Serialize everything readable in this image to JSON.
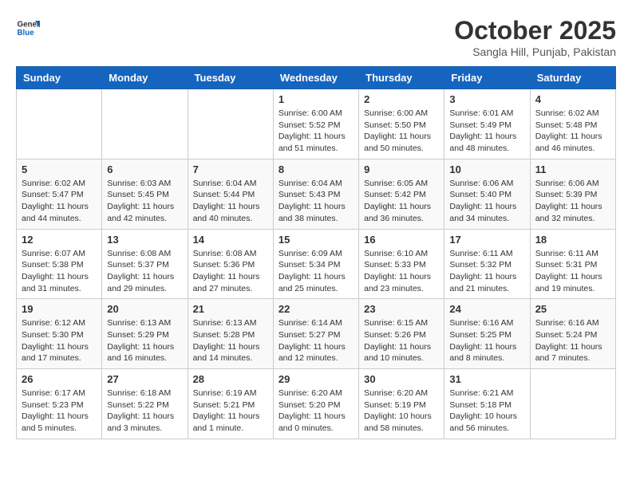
{
  "header": {
    "logo_line1": "General",
    "logo_line2": "Blue",
    "month": "October 2025",
    "location": "Sangla Hill, Punjab, Pakistan"
  },
  "weekdays": [
    "Sunday",
    "Monday",
    "Tuesday",
    "Wednesday",
    "Thursday",
    "Friday",
    "Saturday"
  ],
  "weeks": [
    [
      {
        "day": "",
        "sunrise": "",
        "sunset": "",
        "daylight": ""
      },
      {
        "day": "",
        "sunrise": "",
        "sunset": "",
        "daylight": ""
      },
      {
        "day": "",
        "sunrise": "",
        "sunset": "",
        "daylight": ""
      },
      {
        "day": "1",
        "sunrise": "Sunrise: 6:00 AM",
        "sunset": "Sunset: 5:52 PM",
        "daylight": "Daylight: 11 hours and 51 minutes."
      },
      {
        "day": "2",
        "sunrise": "Sunrise: 6:00 AM",
        "sunset": "Sunset: 5:50 PM",
        "daylight": "Daylight: 11 hours and 50 minutes."
      },
      {
        "day": "3",
        "sunrise": "Sunrise: 6:01 AM",
        "sunset": "Sunset: 5:49 PM",
        "daylight": "Daylight: 11 hours and 48 minutes."
      },
      {
        "day": "4",
        "sunrise": "Sunrise: 6:02 AM",
        "sunset": "Sunset: 5:48 PM",
        "daylight": "Daylight: 11 hours and 46 minutes."
      }
    ],
    [
      {
        "day": "5",
        "sunrise": "Sunrise: 6:02 AM",
        "sunset": "Sunset: 5:47 PM",
        "daylight": "Daylight: 11 hours and 44 minutes."
      },
      {
        "day": "6",
        "sunrise": "Sunrise: 6:03 AM",
        "sunset": "Sunset: 5:45 PM",
        "daylight": "Daylight: 11 hours and 42 minutes."
      },
      {
        "day": "7",
        "sunrise": "Sunrise: 6:04 AM",
        "sunset": "Sunset: 5:44 PM",
        "daylight": "Daylight: 11 hours and 40 minutes."
      },
      {
        "day": "8",
        "sunrise": "Sunrise: 6:04 AM",
        "sunset": "Sunset: 5:43 PM",
        "daylight": "Daylight: 11 hours and 38 minutes."
      },
      {
        "day": "9",
        "sunrise": "Sunrise: 6:05 AM",
        "sunset": "Sunset: 5:42 PM",
        "daylight": "Daylight: 11 hours and 36 minutes."
      },
      {
        "day": "10",
        "sunrise": "Sunrise: 6:06 AM",
        "sunset": "Sunset: 5:40 PM",
        "daylight": "Daylight: 11 hours and 34 minutes."
      },
      {
        "day": "11",
        "sunrise": "Sunrise: 6:06 AM",
        "sunset": "Sunset: 5:39 PM",
        "daylight": "Daylight: 11 hours and 32 minutes."
      }
    ],
    [
      {
        "day": "12",
        "sunrise": "Sunrise: 6:07 AM",
        "sunset": "Sunset: 5:38 PM",
        "daylight": "Daylight: 11 hours and 31 minutes."
      },
      {
        "day": "13",
        "sunrise": "Sunrise: 6:08 AM",
        "sunset": "Sunset: 5:37 PM",
        "daylight": "Daylight: 11 hours and 29 minutes."
      },
      {
        "day": "14",
        "sunrise": "Sunrise: 6:08 AM",
        "sunset": "Sunset: 5:36 PM",
        "daylight": "Daylight: 11 hours and 27 minutes."
      },
      {
        "day": "15",
        "sunrise": "Sunrise: 6:09 AM",
        "sunset": "Sunset: 5:34 PM",
        "daylight": "Daylight: 11 hours and 25 minutes."
      },
      {
        "day": "16",
        "sunrise": "Sunrise: 6:10 AM",
        "sunset": "Sunset: 5:33 PM",
        "daylight": "Daylight: 11 hours and 23 minutes."
      },
      {
        "day": "17",
        "sunrise": "Sunrise: 6:11 AM",
        "sunset": "Sunset: 5:32 PM",
        "daylight": "Daylight: 11 hours and 21 minutes."
      },
      {
        "day": "18",
        "sunrise": "Sunrise: 6:11 AM",
        "sunset": "Sunset: 5:31 PM",
        "daylight": "Daylight: 11 hours and 19 minutes."
      }
    ],
    [
      {
        "day": "19",
        "sunrise": "Sunrise: 6:12 AM",
        "sunset": "Sunset: 5:30 PM",
        "daylight": "Daylight: 11 hours and 17 minutes."
      },
      {
        "day": "20",
        "sunrise": "Sunrise: 6:13 AM",
        "sunset": "Sunset: 5:29 PM",
        "daylight": "Daylight: 11 hours and 16 minutes."
      },
      {
        "day": "21",
        "sunrise": "Sunrise: 6:13 AM",
        "sunset": "Sunset: 5:28 PM",
        "daylight": "Daylight: 11 hours and 14 minutes."
      },
      {
        "day": "22",
        "sunrise": "Sunrise: 6:14 AM",
        "sunset": "Sunset: 5:27 PM",
        "daylight": "Daylight: 11 hours and 12 minutes."
      },
      {
        "day": "23",
        "sunrise": "Sunrise: 6:15 AM",
        "sunset": "Sunset: 5:26 PM",
        "daylight": "Daylight: 11 hours and 10 minutes."
      },
      {
        "day": "24",
        "sunrise": "Sunrise: 6:16 AM",
        "sunset": "Sunset: 5:25 PM",
        "daylight": "Daylight: 11 hours and 8 minutes."
      },
      {
        "day": "25",
        "sunrise": "Sunrise: 6:16 AM",
        "sunset": "Sunset: 5:24 PM",
        "daylight": "Daylight: 11 hours and 7 minutes."
      }
    ],
    [
      {
        "day": "26",
        "sunrise": "Sunrise: 6:17 AM",
        "sunset": "Sunset: 5:23 PM",
        "daylight": "Daylight: 11 hours and 5 minutes."
      },
      {
        "day": "27",
        "sunrise": "Sunrise: 6:18 AM",
        "sunset": "Sunset: 5:22 PM",
        "daylight": "Daylight: 11 hours and 3 minutes."
      },
      {
        "day": "28",
        "sunrise": "Sunrise: 6:19 AM",
        "sunset": "Sunset: 5:21 PM",
        "daylight": "Daylight: 11 hours and 1 minute."
      },
      {
        "day": "29",
        "sunrise": "Sunrise: 6:20 AM",
        "sunset": "Sunset: 5:20 PM",
        "daylight": "Daylight: 11 hours and 0 minutes."
      },
      {
        "day": "30",
        "sunrise": "Sunrise: 6:20 AM",
        "sunset": "Sunset: 5:19 PM",
        "daylight": "Daylight: 10 hours and 58 minutes."
      },
      {
        "day": "31",
        "sunrise": "Sunrise: 6:21 AM",
        "sunset": "Sunset: 5:18 PM",
        "daylight": "Daylight: 10 hours and 56 minutes."
      },
      {
        "day": "",
        "sunrise": "",
        "sunset": "",
        "daylight": ""
      }
    ]
  ]
}
